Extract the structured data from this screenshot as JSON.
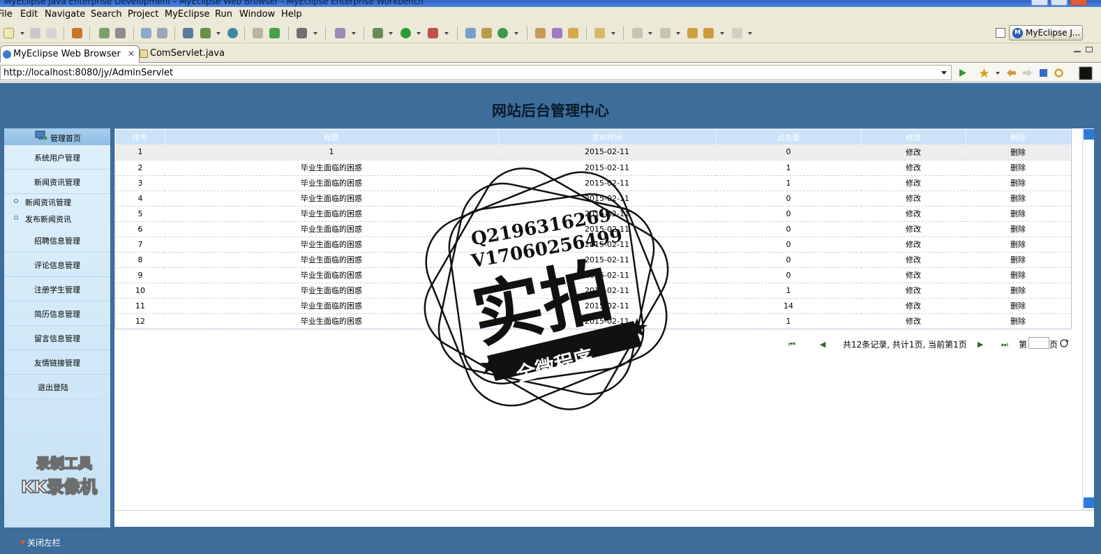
{
  "window": {
    "title": "MyEclipse Java Enterprise Development - MyEclipse Web Browser - MyEclipse Enterprise Workbench"
  },
  "menu": [
    "File",
    "Edit",
    "Navigate",
    "Search",
    "Project",
    "MyEclipse",
    "Run",
    "Window",
    "Help"
  ],
  "perspective": {
    "label": "MyEclipse J..."
  },
  "tabs": [
    {
      "label": "MyEclipse Web Browser",
      "close": "✕"
    },
    {
      "label": "ComServlet.java"
    }
  ],
  "browser": {
    "url": "http://localhost:8080/jy/AdminServlet"
  },
  "page": {
    "title": "网站后台管理中心",
    "sidebar": {
      "header": "管理首页",
      "items": [
        {
          "label": "系统用户管理"
        },
        {
          "label": "新闻资讯管理"
        },
        {
          "label": "招聘信息管理"
        },
        {
          "label": "评论信息管理"
        },
        {
          "label": "注册学生管理"
        },
        {
          "label": "简历信息管理"
        },
        {
          "label": "留言信息管理"
        },
        {
          "label": "友情链接管理"
        },
        {
          "label": "退出登陆"
        }
      ],
      "subitems": [
        {
          "label": "新闻资讯管理"
        },
        {
          "label": "发布新闻资讯"
        }
      ]
    },
    "table": {
      "headers": [
        "序号",
        "标题",
        "发布时间",
        "点击量",
        "修改",
        "删除"
      ],
      "rows": [
        [
          "1",
          "1",
          "2015-02-11",
          "0",
          "修改",
          "删除"
        ],
        [
          "2",
          "毕业生面临的困惑",
          "2015-02-11",
          "1",
          "修改",
          "删除"
        ],
        [
          "3",
          "毕业生面临的困惑",
          "2015-02-11",
          "1",
          "修改",
          "删除"
        ],
        [
          "4",
          "毕业生面临的困惑",
          "2015-02-11",
          "0",
          "修改",
          "删除"
        ],
        [
          "5",
          "毕业生面临的困惑",
          "2015-02-11",
          "0",
          "修改",
          "删除"
        ],
        [
          "6",
          "毕业生面临的困惑",
          "2015-02-11",
          "0",
          "修改",
          "删除"
        ],
        [
          "7",
          "毕业生面临的困惑",
          "2015-02-11",
          "0",
          "修改",
          "删除"
        ],
        [
          "8",
          "毕业生面临的困惑",
          "2015-02-11",
          "0",
          "修改",
          "删除"
        ],
        [
          "9",
          "毕业生面临的困惑",
          "2015-02-11",
          "0",
          "修改",
          "删除"
        ],
        [
          "10",
          "毕业生面临的困惑",
          "2015-02-11",
          "1",
          "修改",
          "删除"
        ],
        [
          "11",
          "毕业生面临的困惑",
          "2015-02-11",
          "14",
          "修改",
          "删除"
        ],
        [
          "12",
          "毕业生面临的困惑",
          "2015-02-11",
          "1",
          "修改",
          "删除"
        ]
      ]
    },
    "pager": {
      "first": "⏮",
      "prev": "◀",
      "summary": "共12条记录, 共计1页, 当前第1页",
      "next": "▶",
      "last": "⏭",
      "page_prefix": "第",
      "page_suffix": "页",
      "page_value": ""
    },
    "footer": {
      "toggle_label": "关闭左栏"
    }
  },
  "overlays": {
    "recorder_watermark": {
      "line1": "录制工具",
      "line2": "KK录像机"
    },
    "stamp": {
      "contact1": "Q2196316269",
      "contact2": "V17060256499",
      "main": "实拍",
      "banner": "全微程序"
    }
  },
  "icons": {
    "toolbar": [
      "new-icon",
      "save-icon",
      "print-icon",
      "package-icon",
      "debug-icon",
      "build-icon",
      "deploy-icon",
      "server-icon",
      "browser-icon",
      "run-icon",
      "search-icon",
      "back-icon",
      "forward-icon"
    ],
    "browser_nav": [
      "go-icon",
      "favorite-icon",
      "back-icon",
      "forward-icon",
      "stop-icon",
      "refresh-icon",
      "terminal-icon"
    ]
  },
  "colors": {
    "header_bg": "#3d6d9b",
    "sidebar_bg": "#c7e2f5",
    "table_header_bg": "#cbe2f8",
    "eclipse_bg": "#ece9d8"
  }
}
